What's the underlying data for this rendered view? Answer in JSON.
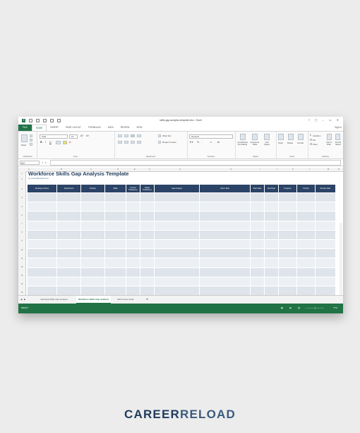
{
  "window": {
    "title": "skills-gap-analysis-template.xlsx - Excel",
    "controls": [
      "?",
      "▢",
      "–",
      "▭",
      "✕"
    ]
  },
  "tabs": [
    "FILE",
    "HOME",
    "INSERT",
    "PAGE LAYOUT",
    "FORMULAS",
    "DATA",
    "REVIEW",
    "VIEW"
  ],
  "signin": "Sign in",
  "ribbon": {
    "paste": "Paste",
    "font_name": "Arial",
    "font_size": "12",
    "wrap_text": "Wrap Text",
    "merge_center": "Merge & Center",
    "number_format": "General",
    "conditional_formatting": "Conditional Formatting",
    "format_as_table": "Format as Table",
    "cell_styles": "Cell Styles",
    "insert": "Insert",
    "delete": "Delete",
    "format": "Format",
    "autosum": "AutoSum",
    "fill": "Fill",
    "clear": "Clear",
    "sort_filter": "Sort & Filter",
    "find_select": "Find & Select",
    "groups": [
      "Clipboard",
      "Font",
      "Alignment",
      "Number",
      "Styles",
      "Cells",
      "Editing"
    ]
  },
  "formula_bar": {
    "name_box": "B27",
    "fx": "fx"
  },
  "columns": [
    "A",
    "B",
    "C",
    "D",
    "E",
    "F",
    "G",
    "H",
    "I",
    "J",
    "K",
    "L",
    "M",
    "N"
  ],
  "rows": [
    "1",
    "2",
    "3",
    "4",
    "5",
    "6",
    "7",
    "8",
    "9",
    "10",
    "11",
    "12",
    "13",
    "14",
    "15"
  ],
  "sheet": {
    "title": "Workforce Skills Gap Analysis Template",
    "subtitle": "by CareerReload.com",
    "headers": [
      "Employee Name",
      "Department",
      "Position",
      "Skills",
      "Current Proficiency",
      "Target Proficiency",
      "Gap Analysis",
      "Action Plan",
      "Start Date",
      "End Date",
      "Progress",
      "Priority",
      "Review Date"
    ],
    "empty_rows": 11
  },
  "sheet_tabs": [
    "Individual Skills Gap Analysis",
    "Workforce Skills Gap Analysis",
    "Skill Levels Guide"
  ],
  "status": {
    "ready": "READY",
    "zoom": "77%"
  },
  "brand": {
    "part1": "CAREER",
    "part2": "RELOAD"
  },
  "colors": {
    "excel_green": "#217346",
    "header_navy": "#2b4366",
    "row_band": "#dfe3ea"
  }
}
